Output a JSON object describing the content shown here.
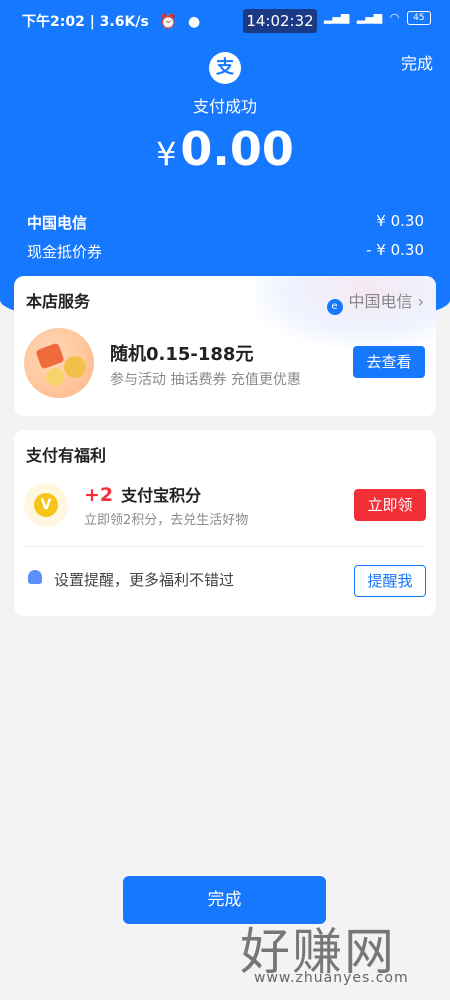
{
  "status_bar": {
    "left": "下午2:02 | 3.6K/s",
    "time": "14:02:32",
    "battery": "45"
  },
  "header": {
    "done_label": "完成",
    "logo_char": "支",
    "status": "支付成功",
    "currency": "¥",
    "amount": "0.00"
  },
  "breakdown": [
    {
      "label": "中国电信",
      "value": "¥ 0.30"
    },
    {
      "label": "现金抵价券",
      "value": "- ¥ 0.30"
    }
  ],
  "store_service": {
    "title": "本店服务",
    "merchant": "中国电信",
    "promo_title": "随机0.15-188元",
    "promo_subtitle": "参与活动 抽话费券 充值更优惠",
    "button": "去查看"
  },
  "benefits": {
    "title": "支付有福利",
    "points_plus": "+2",
    "points_title": "支付宝积分",
    "points_subtitle": "立即领2积分，去兑生活好物",
    "claim_button": "立即领",
    "remind_text": "设置提醒，更多福利不错过",
    "remind_button": "提醒我"
  },
  "footer": {
    "done_button": "完成"
  },
  "watermark": {
    "text": "好赚网",
    "url": "www.zhuanyes.com"
  },
  "colors": {
    "primary": "#1677ff",
    "danger": "#f22f36"
  }
}
